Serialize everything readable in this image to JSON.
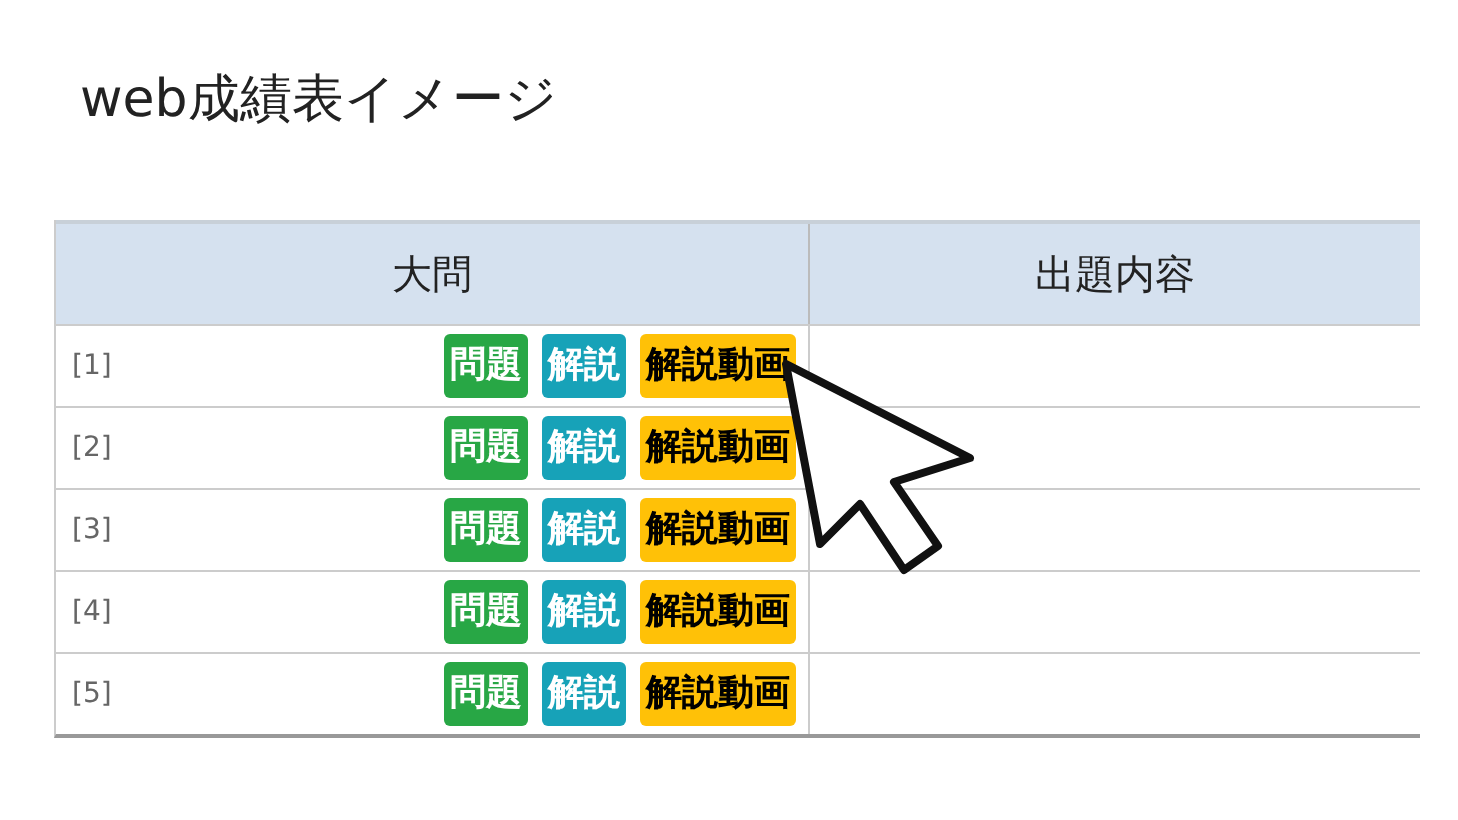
{
  "title": "web成績表イメージ",
  "table": {
    "columns": [
      "大問",
      "出題内容"
    ],
    "rows": [
      {
        "label": "[1]",
        "buttons": [
          {
            "kind": "question",
            "label": "問題"
          },
          {
            "kind": "explanation",
            "label": "解説"
          },
          {
            "kind": "video",
            "label": "解説動画"
          }
        ]
      },
      {
        "label": "[2]",
        "buttons": [
          {
            "kind": "question",
            "label": "問題"
          },
          {
            "kind": "explanation",
            "label": "解説"
          },
          {
            "kind": "video",
            "label": "解説動画"
          }
        ]
      },
      {
        "label": "[3]",
        "buttons": [
          {
            "kind": "question",
            "label": "問題"
          },
          {
            "kind": "explanation",
            "label": "解説"
          },
          {
            "kind": "video",
            "label": "解説動画"
          }
        ]
      },
      {
        "label": "[4]",
        "buttons": [
          {
            "kind": "question",
            "label": "問題"
          },
          {
            "kind": "explanation",
            "label": "解説"
          },
          {
            "kind": "video",
            "label": "解説動画"
          }
        ]
      },
      {
        "label": "[5]",
        "buttons": [
          {
            "kind": "question",
            "label": "問題"
          },
          {
            "kind": "explanation",
            "label": "解説"
          },
          {
            "kind": "video",
            "label": "解説動画"
          }
        ]
      }
    ]
  }
}
